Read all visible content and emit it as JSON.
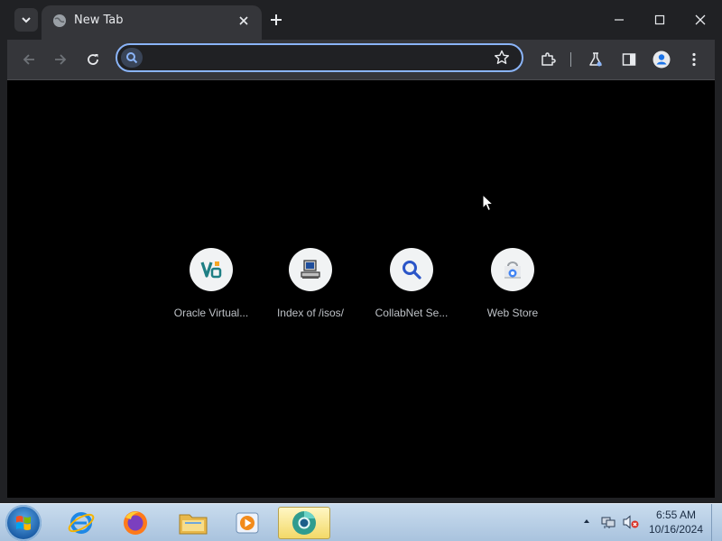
{
  "browser": {
    "tab": {
      "title": "New Tab"
    },
    "omnibox": {
      "value": "",
      "placeholder": ""
    },
    "shortcuts": [
      {
        "label": "Oracle Virtual...",
        "icon": "virtualbox-icon"
      },
      {
        "label": "Index of /isos/",
        "icon": "computer-icon"
      },
      {
        "label": "CollabNet Se...",
        "icon": "search-icon"
      },
      {
        "label": "Web Store",
        "icon": "web-store-icon"
      }
    ],
    "colors": {
      "frame": "#202124",
      "toolbar": "#35363a",
      "focus_ring": "#8ab4f8",
      "content_bg": "#000000"
    }
  },
  "taskbar": {
    "clock": {
      "time": "6:55 AM",
      "date": "10/16/2024"
    },
    "pinned": [
      "internet-explorer-icon",
      "firefox-icon",
      "file-explorer-icon",
      "media-player-icon",
      "chrome-canary-icon"
    ]
  }
}
